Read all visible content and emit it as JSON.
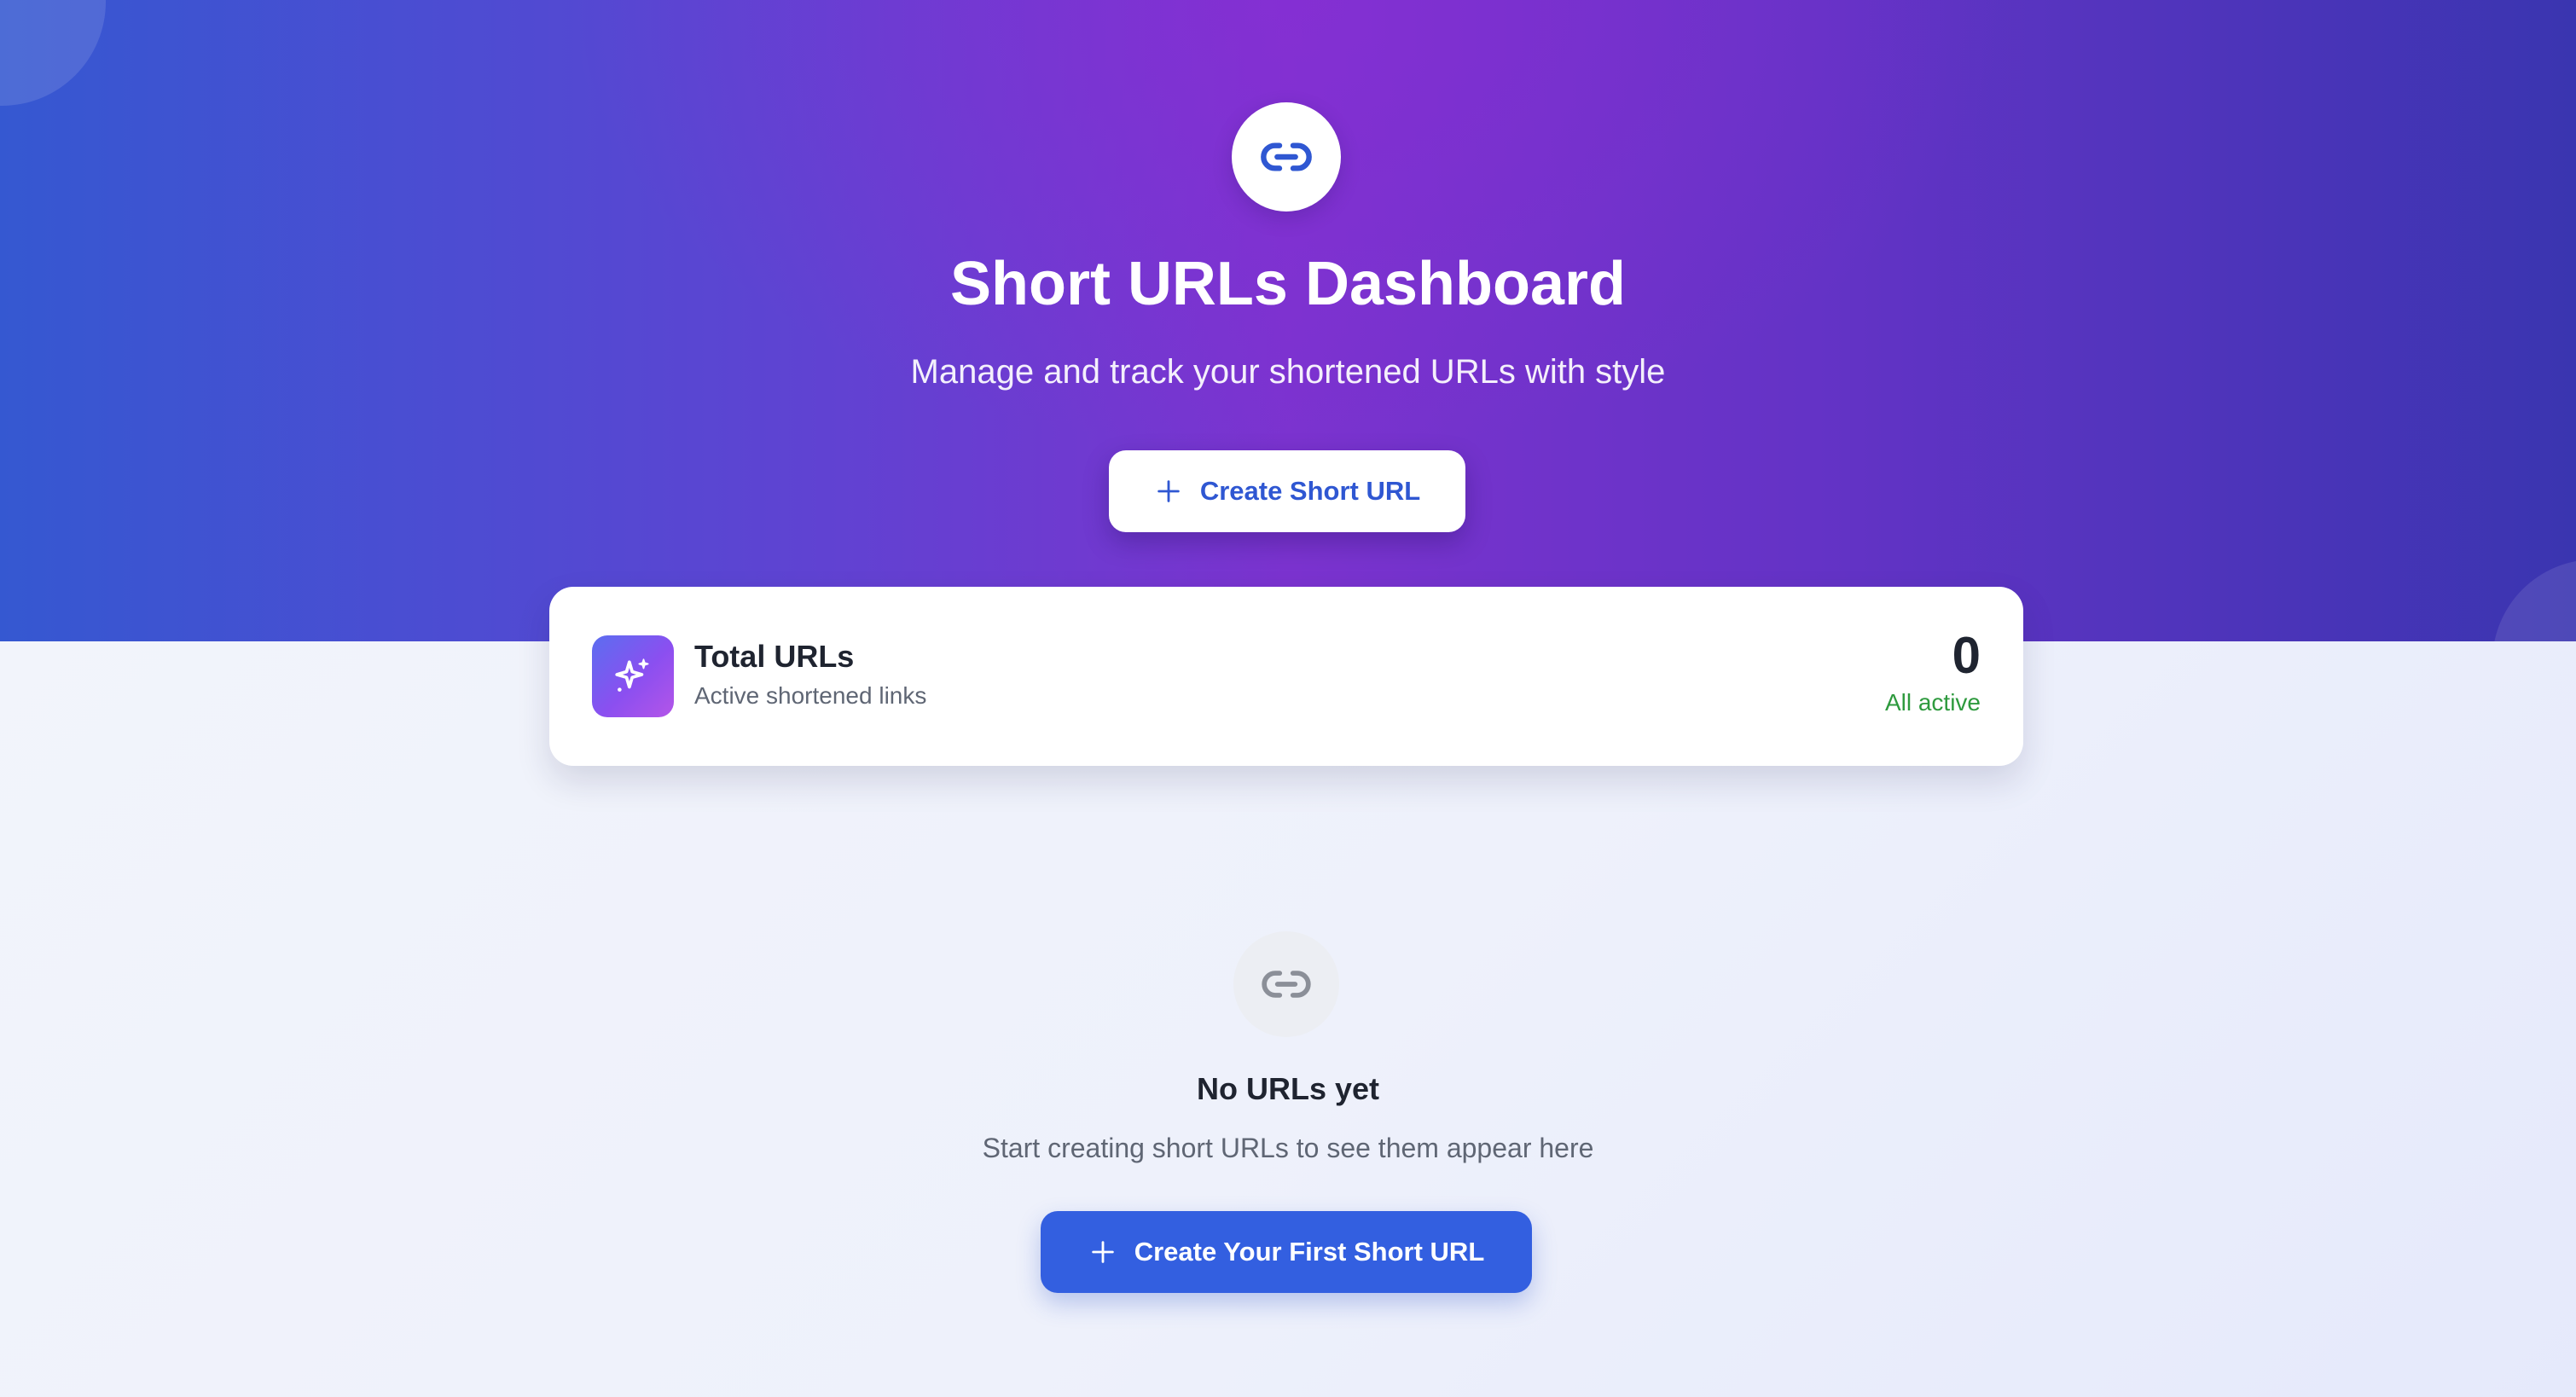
{
  "header": {
    "title": "Short URLs Dashboard",
    "subtitle": "Manage and track your shortened URLs with style",
    "icon": "link-icon",
    "create_button_label": "Create Short URL"
  },
  "stats": {
    "label": "Total URLs",
    "description": "Active shortened links",
    "value": "0",
    "status": "All active",
    "icon": "sparkles-icon"
  },
  "empty_state": {
    "icon": "link-icon",
    "title": "No URLs yet",
    "message": "Start creating short URLs to see them appear here",
    "button_label": "Create Your First Short URL"
  },
  "colors": {
    "primary": "#335fe0",
    "hero_gradient_start": "#3558d1",
    "hero_gradient_mid": "#7b33cf",
    "hero_gradient_end": "#3a35b0",
    "success": "#2e9a3e"
  }
}
